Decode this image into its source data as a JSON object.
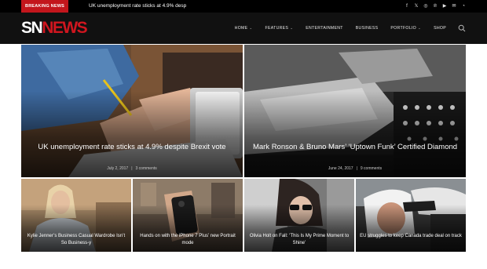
{
  "topbar": {
    "breaking_label": "BREAKING NEWS",
    "ticker": "UK unemployment rate sticks at 4.9% desp",
    "social_icons": [
      "facebook-icon",
      "twitter-icon",
      "instagram-icon",
      "pinterest-icon",
      "youtube-icon",
      "email-icon",
      "rss-icon"
    ]
  },
  "header": {
    "logo_sn": "SN",
    "logo_news": "NEWS",
    "nav": [
      {
        "label": "HOME",
        "has_dropdown": true
      },
      {
        "label": "FEATURES",
        "has_dropdown": true
      },
      {
        "label": "ENTERTAINMENT",
        "has_dropdown": false
      },
      {
        "label": "BUSINESS",
        "has_dropdown": false
      },
      {
        "label": "PORTFOLIO",
        "has_dropdown": true
      },
      {
        "label": "SHOP",
        "has_dropdown": false
      }
    ]
  },
  "featured": [
    {
      "title": "UK unemployment rate sticks at 4.9% despite Brexit vote",
      "date": "July 2, 2017",
      "comments": "3 comments"
    },
    {
      "title": "Mark Ronson & Bruno Mars’ ‘Uptown Funk’ Certified Diamond",
      "date": "June 24, 2017",
      "comments": "9 comments"
    }
  ],
  "secondary": [
    {
      "title": "Kylie Jenner’s Business Casual Wardrobe Isn’t So Business-y"
    },
    {
      "title": "Hands on with the iPhone 7 Plus’ new Portrait mode"
    },
    {
      "title": "Olivia Holt on Fall: ‘This Is My Prime Moment to Shine’"
    },
    {
      "title": "EU struggles to keep Canada trade deal on track"
    }
  ],
  "colors": {
    "brand_red": "#d0161f",
    "topbar": "#000000",
    "header": "#111111"
  }
}
